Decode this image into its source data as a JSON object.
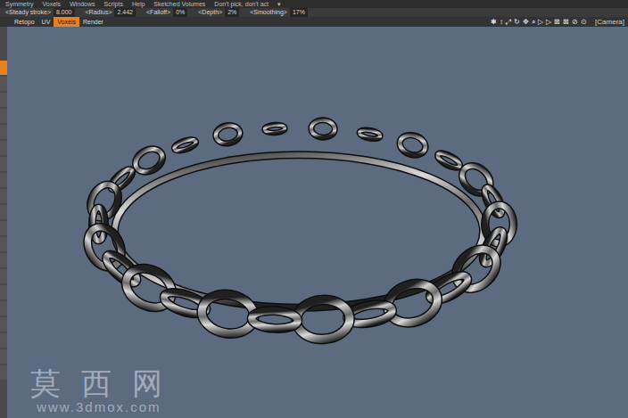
{
  "menu": [
    {
      "label": "Symmetry"
    },
    {
      "label": "Voxels"
    },
    {
      "label": "Windows"
    },
    {
      "label": "Scripts"
    },
    {
      "label": "Help"
    },
    {
      "label": "Sketched Volumes"
    },
    {
      "label": "Don't pick, don't act"
    },
    {
      "label": "▾"
    }
  ],
  "tool_options": [
    {
      "label": "<Steady stroke>",
      "value": "8.000"
    },
    {
      "label": "<Radius>",
      "value": "2.442"
    },
    {
      "label": "<Falloff>",
      "value": "0%"
    },
    {
      "label": "<Depth>",
      "value": "2%"
    },
    {
      "label": "<Smoothing>",
      "value": "17%"
    }
  ],
  "tabs": [
    {
      "label": "Retopo",
      "selected": false
    },
    {
      "label": "UV",
      "selected": false
    },
    {
      "label": "Voxels",
      "selected": true
    },
    {
      "label": "Render",
      "selected": false
    }
  ],
  "view_icons": [
    "✱",
    "↕",
    "⤢",
    "↻",
    "✥",
    "⌕",
    "▷",
    "▷",
    "⊠",
    "⊠",
    "⊘",
    "⊙"
  ],
  "viewport": {
    "camera_label": "[Camera]"
  },
  "sidebar": {
    "slots": [
      {
        "selected": true
      },
      {
        "selected": false
      },
      {
        "selected": false
      },
      {
        "selected": false
      },
      {
        "selected": false
      },
      {
        "selected": false
      },
      {
        "selected": false
      },
      {
        "selected": false
      },
      {
        "selected": false
      },
      {
        "selected": false
      },
      {
        "selected": false
      },
      {
        "selected": false
      },
      {
        "selected": false
      },
      {
        "selected": false
      },
      {
        "selected": false
      },
      {
        "selected": false
      },
      {
        "selected": false
      },
      {
        "selected": false
      },
      {
        "selected": false
      },
      {
        "selected": false
      }
    ]
  },
  "watermark": {
    "title": "莫 西 网",
    "url": "www.3dmox.com"
  }
}
